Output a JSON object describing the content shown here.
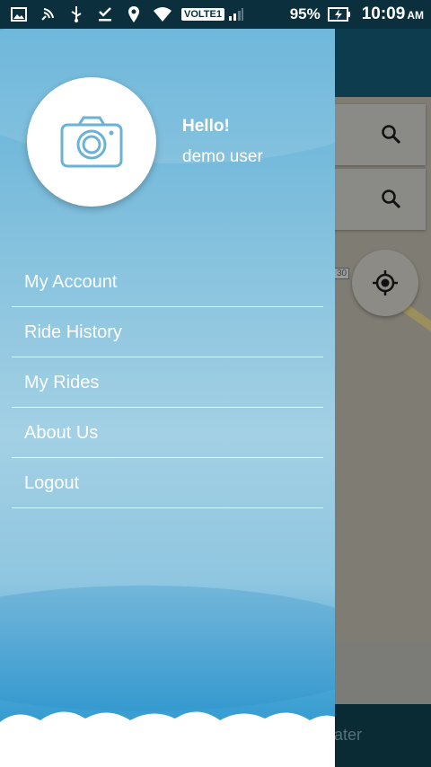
{
  "status_bar": {
    "volte": "VOLTE1",
    "battery": "95%",
    "time": "10:09",
    "ampm": "AM"
  },
  "background_app": {
    "bottom_text": "ater",
    "route_badge": "30"
  },
  "drawer": {
    "greeting": "Hello!",
    "username": "demo user",
    "menu": [
      {
        "label": "My Account"
      },
      {
        "label": "Ride History"
      },
      {
        "label": "My Rides"
      },
      {
        "label": "About Us"
      },
      {
        "label": "Logout"
      }
    ]
  },
  "icons": {
    "avatar": "camera-icon",
    "search": "search-icon",
    "locate": "my-location-icon"
  },
  "colors": {
    "drawer_top": "#5fb0d8",
    "drawer_mid": "#a3d0e4",
    "drawer_bottom": "#2a92cc",
    "camera_icon": "#6ab2d6",
    "status_bar": "#0b2f3c"
  }
}
